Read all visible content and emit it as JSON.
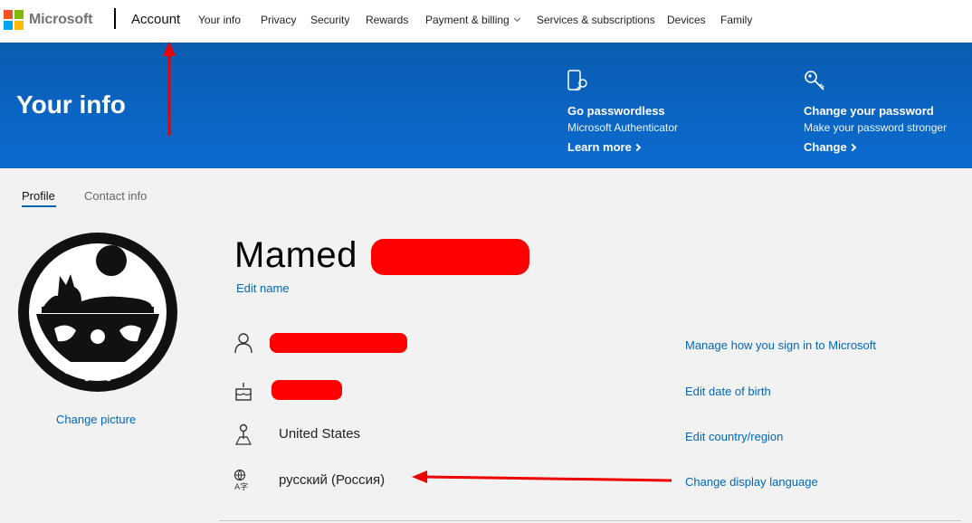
{
  "nav": {
    "brand": "Microsoft",
    "account": "Account",
    "items": [
      "Your info",
      "Privacy",
      "Security",
      "Rewards",
      "Payment & billing",
      "Services & subscriptions",
      "Devices",
      "Family"
    ]
  },
  "hero": {
    "title": "Your info",
    "promos": [
      {
        "heading": "Go passwordless",
        "sub": "Microsoft Authenticator",
        "link": "Learn more",
        "icon": "phone-key-icon"
      },
      {
        "heading": "Change your password",
        "sub": "Make your password stronger",
        "link": "Change",
        "icon": "key-icon"
      }
    ]
  },
  "tabs": {
    "profile": "Profile",
    "contact": "Contact info"
  },
  "profile": {
    "first_name": "Mamed",
    "edit_name": "Edit name",
    "change_picture": "Change picture",
    "rows": [
      {
        "icon": "person-icon",
        "value": "",
        "link": "Manage how you sign in to Microsoft"
      },
      {
        "icon": "cake-icon",
        "value": "",
        "link": "Edit date of birth"
      },
      {
        "icon": "location-icon",
        "value": "United States",
        "link": "Edit country/region"
      },
      {
        "icon": "language-icon",
        "value": "русский (Россия)",
        "link": "Change display language"
      }
    ]
  },
  "colors": {
    "accent": "#0067b8",
    "hero": "#0a64c2",
    "annotation": "#ff0000"
  }
}
